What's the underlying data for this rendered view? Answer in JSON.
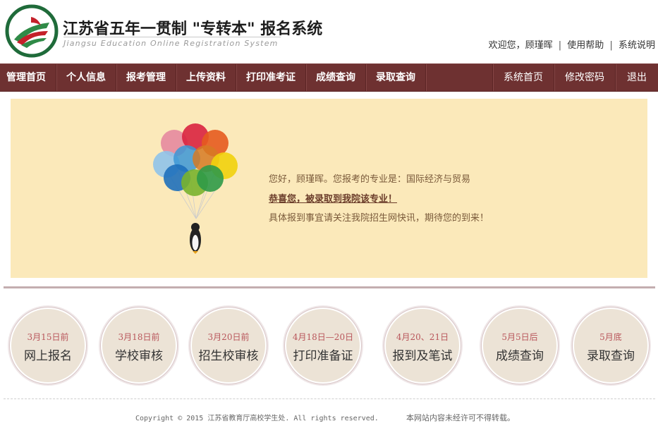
{
  "header": {
    "title": "江苏省五年一贯制 \"专转本\" 报名系统",
    "subtitle": "Jiangsu Education Online Registration System",
    "welcome": "欢迎您，顾瑾晖",
    "help": "使用帮助",
    "about": "系统说明",
    "separator": "|"
  },
  "nav": {
    "left": [
      "管理首页",
      "个人信息",
      "报考管理",
      "上传资料",
      "打印准考证",
      "成绩查询",
      "录取查询"
    ],
    "right": [
      "系统首页",
      "修改密码",
      "退出"
    ]
  },
  "notice": {
    "line1": "您好，顾瑾晖。您报考的专业是：国际经济与贸易",
    "line2": "恭喜您，被录取到我院该专业！",
    "line3": "具体报到事宜请关注我院招生网快讯，期待您的到来！"
  },
  "steps": [
    {
      "date": "3月15日前",
      "label": "网上报名"
    },
    {
      "date": "3月18日前",
      "label": "学校审核"
    },
    {
      "date": "3月20日前",
      "label": "招生校审核"
    },
    {
      "date": "4月18日—20日",
      "label": "打印准备证"
    },
    {
      "date": "4月20、21日",
      "label": "报到及笔试"
    },
    {
      "date": "5月5日后",
      "label": "成绩查询"
    },
    {
      "date": "5月底",
      "label": "录取查询"
    }
  ],
  "footer": {
    "copyright": "Copyright © 2015 江苏省教育厅高校学生处. All rights reserved.",
    "notice": "本网站内容未经许可不得转载。"
  },
  "colors": {
    "nav_bg": "#6e3131",
    "notice_bg": "#fbe9ba",
    "step_bg": "#ece3d6",
    "step_date": "#b9565b"
  },
  "icons": {
    "logo": "school-logo-icon",
    "balloons": "balloons-penguin-icon"
  }
}
